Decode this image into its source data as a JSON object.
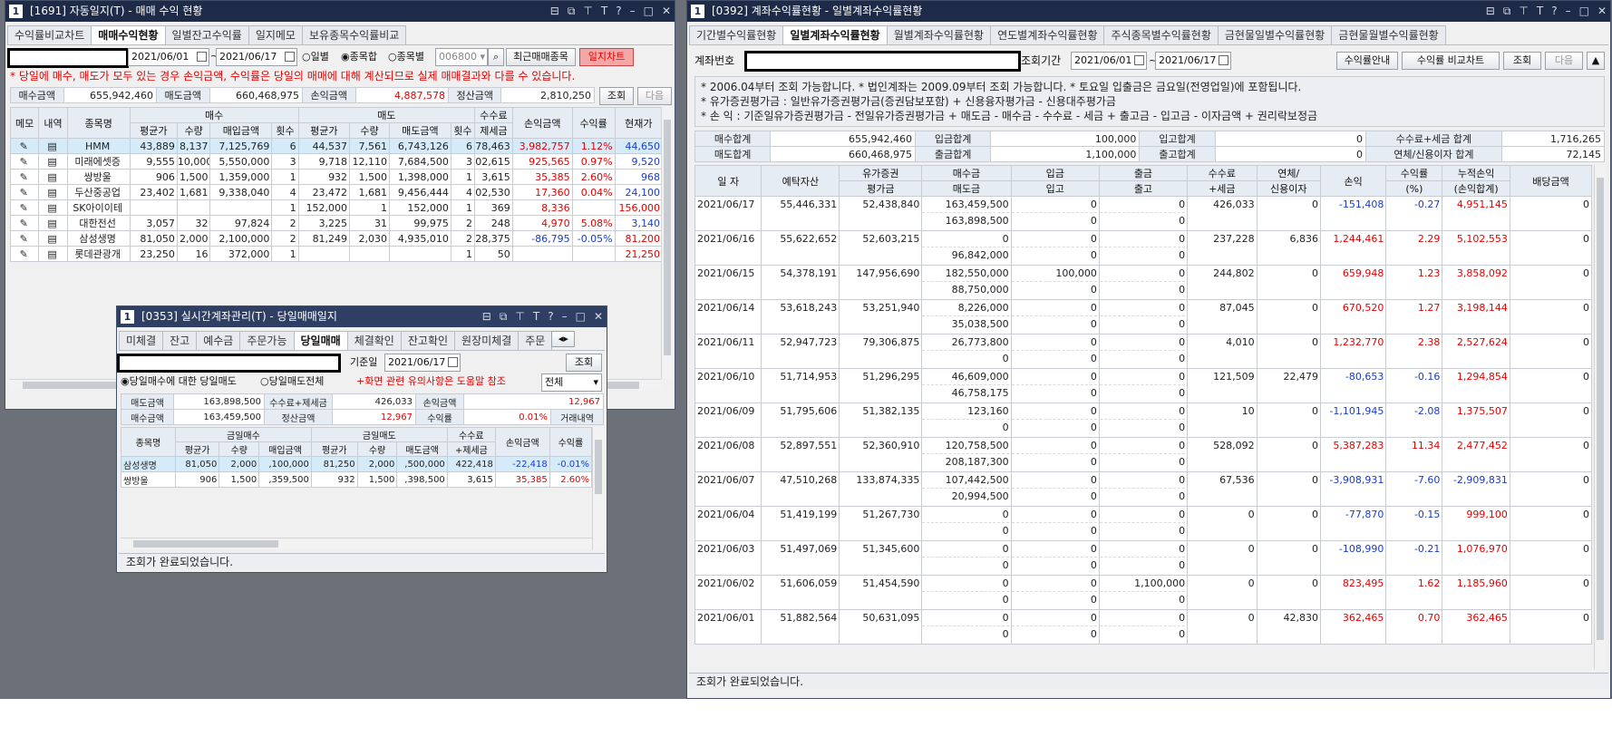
{
  "w1": {
    "num": "1",
    "title": "[1691] 자동일지(T) - 매매 수익 현황",
    "tabs": [
      "수익률비교차트",
      "매매수익현황",
      "일별잔고수익률",
      "일지메모",
      "보유종목수익률비교"
    ],
    "date_from": "2021/06/01",
    "date_to": "2021/06/17",
    "radio_daily": "○일별",
    "radio_sum": "◉종목합",
    "radio_item": "○종목별",
    "code": "006800",
    "recent_btn": "최근매매종목",
    "journal_btn": "일지차트",
    "warning": "* 당일에 매수, 매도가 모두 있는 경우 손익금액, 수익률은 당일의 매매에 대해 계산되므로 실제 매매결과와 다를 수 있습니다.",
    "sum": {
      "buy_lbl": "매수금액",
      "buy": "655,942,460",
      "sell_lbl": "매도금액",
      "sell": "660,468,975",
      "pl_lbl": "손익금액",
      "pl": "4,887,578",
      "settle_lbl": "정산금액",
      "settle": "2,810,250"
    },
    "query_btn": "조회",
    "next_btn": "다음",
    "hdr": {
      "memo": "메모",
      "detail": "내역",
      "name": "종목명",
      "buy": "매수",
      "sell": "매도",
      "avg": "평균가",
      "qty": "수량",
      "buy_amt": "매입금액",
      "cnt": "횟수",
      "avg2": "평균가",
      "qty2": "수량",
      "sell_amt": "매도금액",
      "cnt2": "횟수",
      "fee": "수수료",
      "tax": "제세금",
      "pl": "손익금액",
      "rate": "수익률",
      "cur": "현재가"
    },
    "rows": [
      [
        "HMM",
        "43,889",
        "8,137",
        "7,125,769",
        "6",
        "44,537",
        "7,561",
        "6,743,126",
        "6",
        "78,463",
        "3,982,757",
        "1.12%",
        "44,650"
      ],
      [
        "미래에셋증",
        "9,555",
        "10,000",
        "5,550,000",
        "3",
        "9,718",
        "12,110",
        "7,684,500",
        "3",
        "02,615",
        "925,565",
        "0.97%",
        "9,520"
      ],
      [
        "쌍방울",
        "906",
        "1,500",
        "1,359,000",
        "1",
        "932",
        "1,500",
        "1,398,000",
        "1",
        "3,615",
        "35,385",
        "2.60%",
        "968"
      ],
      [
        "두산중공업",
        "23,402",
        "1,681",
        "9,338,040",
        "4",
        "23,472",
        "1,681",
        "9,456,444",
        "4",
        "02,530",
        "17,360",
        "0.04%",
        "24,100"
      ],
      [
        "SK아이이테",
        "",
        "",
        "",
        "1",
        "152,000",
        "1",
        "152,000",
        "1",
        "369",
        "8,336",
        "",
        "156,000"
      ],
      [
        "대한전선",
        "3,057",
        "32",
        "97,824",
        "2",
        "3,225",
        "31",
        "99,975",
        "2",
        "248",
        "4,970",
        "5.08%",
        "3,140"
      ],
      [
        "삼성생명",
        "81,050",
        "2,000",
        "2,100,000",
        "2",
        "81,249",
        "2,030",
        "4,935,010",
        "2",
        "28,375",
        "-86,795",
        "-0.05%",
        "81,200"
      ],
      [
        "롯데관광개",
        "23,250",
        "16",
        "372,000",
        "1",
        "",
        "",
        "",
        "1",
        "50",
        "",
        "",
        "21,250"
      ]
    ],
    "colors": [
      "red",
      "red",
      "red",
      "red",
      "red",
      "red",
      "blue",
      "red"
    ],
    "curcolors": [
      "blue",
      "blue",
      "blue",
      "blue",
      "red",
      "blue",
      "red",
      "red"
    ]
  },
  "w2": {
    "num": "1",
    "title": "[0353] 실시간계좌관리(T) - 당일매매일지",
    "tabs": [
      "미체결",
      "잔고",
      "예수금",
      "주문가능",
      "당일매매",
      "체결확인",
      "잔고확인",
      "원장미체결",
      "주문"
    ],
    "date_lbl": "기준일",
    "date": "2021/06/17",
    "query_btn": "조회",
    "radio1": "◉당일매수에 대한 당일매도",
    "radio2": "○당일매도전체",
    "note": "+화면 관련 유의사항은 도움말 참조",
    "filter": "전체",
    "s": {
      "bl": "매도금액",
      "bv": "163,898,500",
      "fl": "수수료+제세금",
      "fv": "426,033",
      "pl": "손익금액",
      "pv": "12,967",
      "sl": "매수금액",
      "sv": "163,459,500",
      "stl": "정산금액",
      "stv": "12,967",
      "rl": "수익률",
      "rv": "0.01%",
      "tl": "거래내역"
    },
    "hdr": {
      "name": "종목명",
      "buy": "금일매수",
      "sell": "금일매도",
      "avg": "평균가",
      "qty": "수량",
      "amt": "매입금액",
      "avg2": "평균가",
      "qty2": "수량",
      "amt2": "매도금액",
      "fee": "수수료",
      "tax": "+제세금",
      "pl": "손익금액",
      "rate": "수익률"
    },
    "rows": [
      [
        "삼성생명",
        "81,050",
        "2,000",
        ",100,000",
        "81,250",
        "2,000",
        ",500,000",
        "422,418",
        "-22,418",
        "-0.01%"
      ],
      [
        "쌍방울",
        "906",
        "1,500",
        ",359,500",
        "932",
        "1,500",
        ",398,500",
        "3,615",
        "35,385",
        "2.60%"
      ]
    ],
    "status": "조회가 완료되었습니다."
  },
  "w3": {
    "num": "1",
    "title": "[0392] 계좌수익률현황 - 일별계좌수익률현황",
    "tabs": [
      "기간별수익률현황",
      "일별계좌수익률현황",
      "월별계좌수익률현황",
      "연도별계좌수익률현황",
      "주식종목별수익률현황",
      "금현물일별수익률현황",
      "금현물월별수익률현황"
    ],
    "acct_lbl": "계좌번호",
    "period_lbl": "조회기간",
    "date_from": "2021/06/01",
    "date_to": "2021/06/17",
    "btn_guide": "수익률안내",
    "btn_chart": "수익률 비교차트",
    "query_btn": "조회",
    "next_btn": "다음",
    "info": [
      "* 2006.04부터 조회 가능합니다.   * 법인계좌는 2009.09부터 조회 가능합니다.   * 토요일 입출금은 금요일(전영업일)에 포함됩니다.",
      "* 유가증권평가금 : 일반유가증권평가금(증권담보포함) + 신용융자평가금 - 신용대주평가금",
      "* 손        익 : 기준일유가증권평가금 - 전일유가증권평가금 + 매도금 - 매수금 - 수수료 - 세금 + 출고금 - 입고금 - 이자금액 + 권리락보정금"
    ],
    "sum": [
      [
        "매수합계",
        "655,942,460",
        "입금합계",
        "100,000",
        "입고합계",
        "0",
        "수수료+세금 합계",
        "1,716,265"
      ],
      [
        "매도합계",
        "660,468,975",
        "출금합계",
        "1,100,000",
        "출고합계",
        "0",
        "연체/신용이자 합계",
        "72,145"
      ]
    ],
    "hdr": {
      "date": "일 자",
      "dep": "예탁자산",
      "sec": "유가증권",
      "sec2": "평가금",
      "buy": "매수금",
      "sell": "매도금",
      "in": "입금",
      "inq": "입고",
      "out": "출금",
      "outq": "출고",
      "fee": "수수료",
      "fee2": "+세금",
      "int": "연체/",
      "int2": "신용이자",
      "pl": "손익",
      "rate": "수익률",
      "rate2": "(%)",
      "cum": "누적손익",
      "cum2": "(손익합계)",
      "div": "배당금액"
    },
    "rows": [
      [
        "2021/06/17",
        "55,446,331",
        "52,438,840",
        "163,459,500",
        "163,898,500",
        "0",
        "0",
        "0",
        "0",
        "426,033",
        "0",
        "-151,408",
        "-0.27",
        "4,951,145",
        "0"
      ],
      [
        "2021/06/16",
        "55,622,652",
        "52,603,215",
        "0",
        "96,842,000",
        "0",
        "0",
        "0",
        "0",
        "237,228",
        "6,836",
        "1,244,461",
        "2.29",
        "5,102,553",
        "0"
      ],
      [
        "2021/06/15",
        "54,378,191",
        "147,956,690",
        "182,550,000",
        "88,750,000",
        "100,000",
        "0",
        "0",
        "0",
        "244,802",
        "0",
        "659,948",
        "1.23",
        "3,858,092",
        "0"
      ],
      [
        "2021/06/14",
        "53,618,243",
        "53,251,940",
        "8,226,000",
        "35,038,500",
        "0",
        "0",
        "0",
        "0",
        "87,045",
        "0",
        "670,520",
        "1.27",
        "3,198,144",
        "0"
      ],
      [
        "2021/06/11",
        "52,947,723",
        "79,306,875",
        "26,773,800",
        "0",
        "0",
        "0",
        "0",
        "0",
        "4,010",
        "0",
        "1,232,770",
        "2.38",
        "2,527,624",
        "0"
      ],
      [
        "2021/06/10",
        "51,714,953",
        "51,296,295",
        "46,609,000",
        "46,758,175",
        "0",
        "0",
        "0",
        "0",
        "121,509",
        "22,479",
        "-80,653",
        "-0.16",
        "1,294,854",
        "0"
      ],
      [
        "2021/06/09",
        "51,795,606",
        "51,382,135",
        "123,160",
        "0",
        "0",
        "0",
        "0",
        "0",
        "10",
        "0",
        "-1,101,945",
        "-2.08",
        "1,375,507",
        "0"
      ],
      [
        "2021/06/08",
        "52,897,551",
        "52,360,910",
        "120,758,500",
        "208,187,300",
        "0",
        "0",
        "0",
        "0",
        "528,092",
        "0",
        "5,387,283",
        "11.34",
        "2,477,452",
        "0"
      ],
      [
        "2021/06/07",
        "47,510,268",
        "133,874,335",
        "107,442,500",
        "20,994,500",
        "0",
        "0",
        "0",
        "0",
        "67,536",
        "0",
        "-3,908,931",
        "-7.60",
        "-2,909,831",
        "0"
      ],
      [
        "2021/06/04",
        "51,419,199",
        "51,267,730",
        "0",
        "0",
        "0",
        "0",
        "0",
        "0",
        "0",
        "0",
        "-77,870",
        "-0.15",
        "999,100",
        "0"
      ],
      [
        "2021/06/03",
        "51,497,069",
        "51,345,600",
        "0",
        "0",
        "0",
        "0",
        "0",
        "0",
        "0",
        "0",
        "-108,990",
        "-0.21",
        "1,076,970",
        "0"
      ],
      [
        "2021/06/02",
        "51,606,059",
        "51,454,590",
        "0",
        "0",
        "0",
        "0",
        "1,100,000",
        "0",
        "0",
        "0",
        "823,495",
        "1.62",
        "1,185,960",
        "0"
      ],
      [
        "2021/06/01",
        "51,882,564",
        "50,631,095",
        "0",
        "0",
        "0",
        "0",
        "0",
        "0",
        "0",
        "42,830",
        "362,465",
        "0.70",
        "362,465",
        "0"
      ]
    ],
    "status": "조회가 완료되었습니다."
  }
}
